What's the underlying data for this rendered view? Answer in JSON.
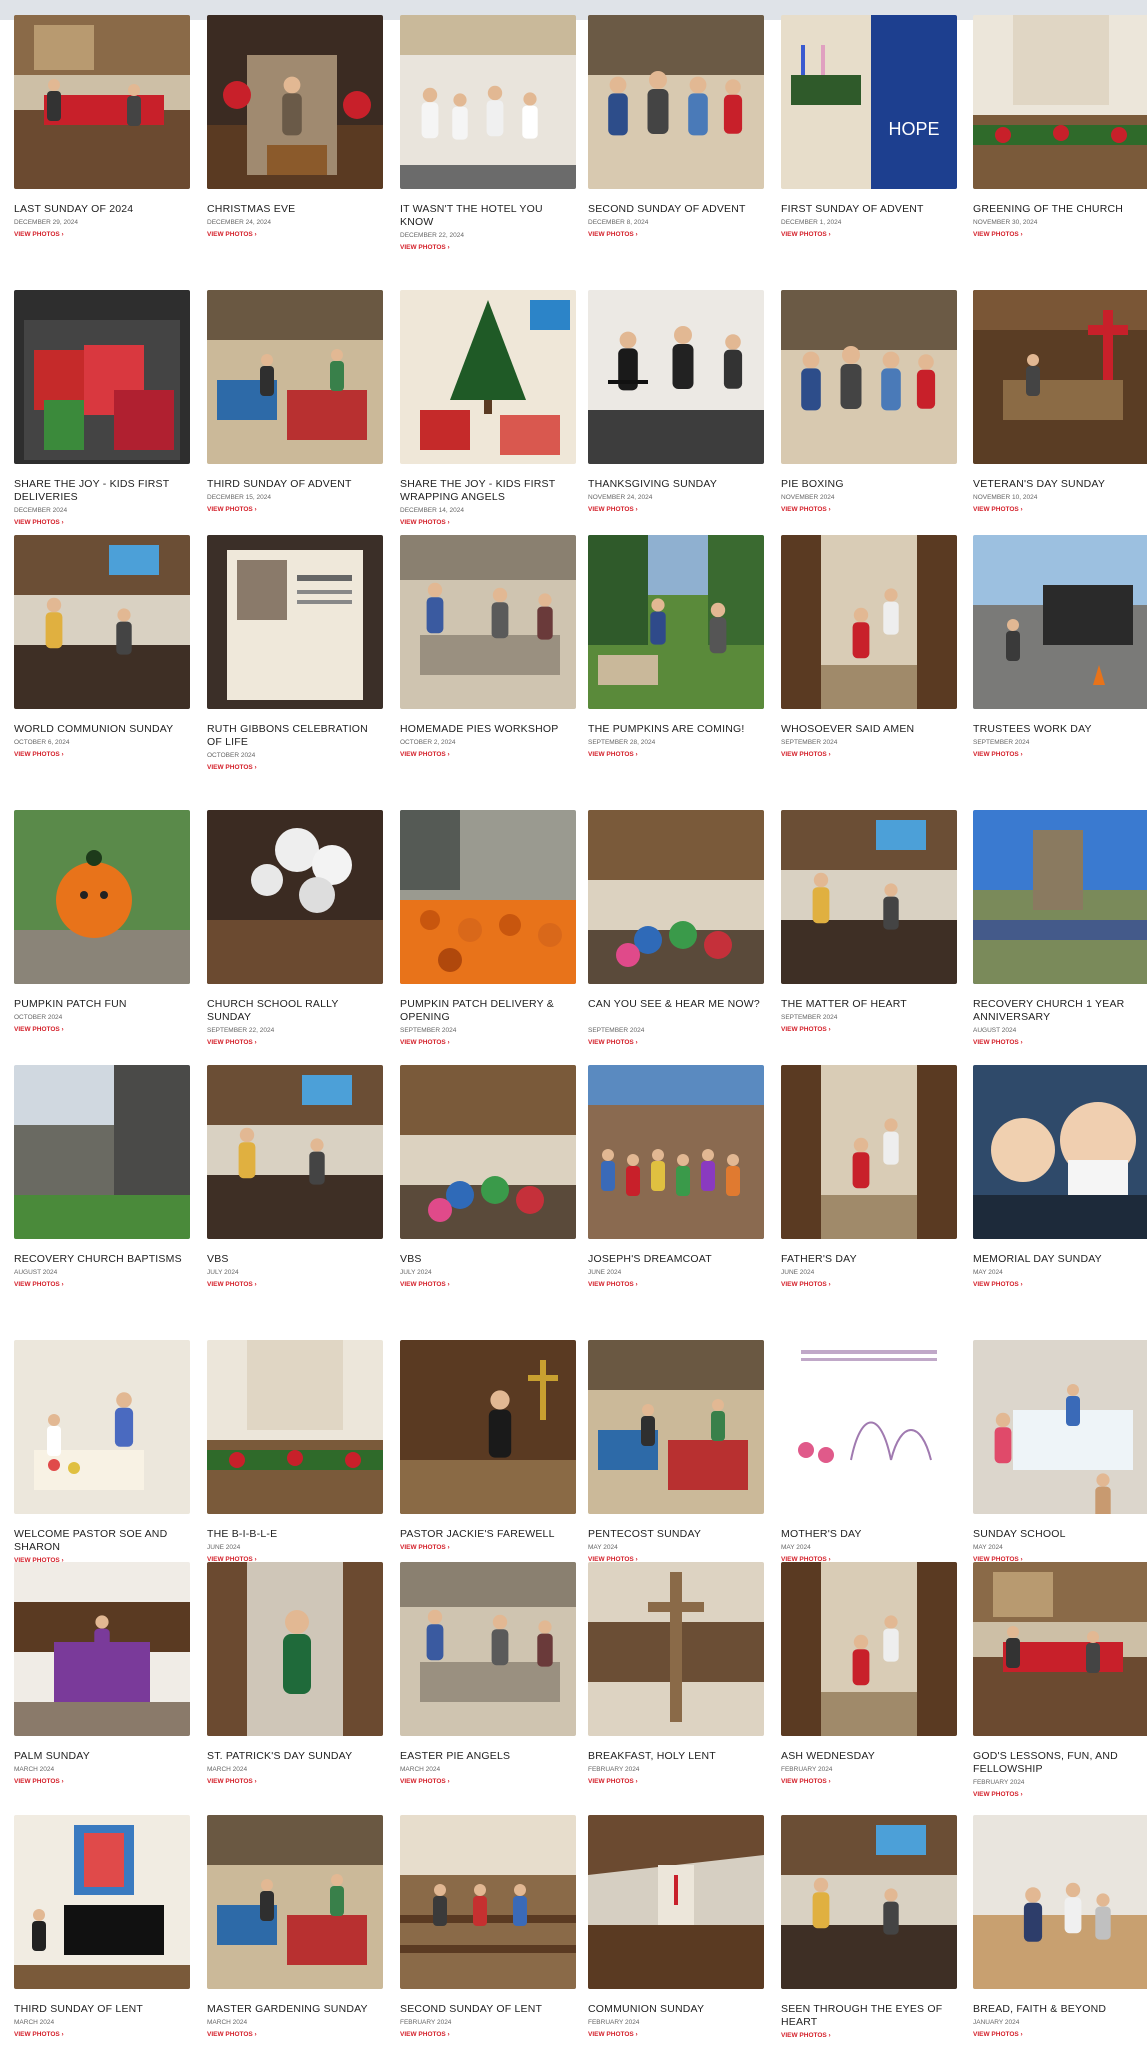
{
  "gallery": {
    "link_label": "VIEW PHOTOS ›",
    "rows": [
      [
        {
          "title": "LAST SUNDAY OF 2024",
          "date": "DECEMBER 29, 2024",
          "theme": "sanctuary-red"
        },
        {
          "title": "CHRISTMAS EVE",
          "date": "DECEMBER 24, 2024",
          "theme": "nativity"
        },
        {
          "title": "IT WASN'T THE HOTEL YOU KNOW",
          "date": "DECEMBER 22, 2024",
          "theme": "pageant"
        },
        {
          "title": "SECOND SUNDAY OF ADVENT",
          "date": "DECEMBER 8, 2024",
          "theme": "people-group"
        },
        {
          "title": "FIRST SUNDAY OF ADVENT",
          "date": "DECEMBER 1, 2024",
          "theme": "hope-banner"
        },
        {
          "title": "GREENING OF THE CHURCH",
          "date": "NOVEMBER 30, 2024",
          "theme": "chancel-green"
        }
      ],
      [
        {
          "title": "SHARE THE JOY - KIDS FIRST DELIVERIES",
          "date": "DECEMBER 2024",
          "theme": "gifts-van"
        },
        {
          "title": "THIRD SUNDAY OF ADVENT",
          "date": "DECEMBER 15, 2024",
          "theme": "hall-gifts"
        },
        {
          "title": "SHARE THE JOY - KIDS FIRST WRAPPING ANGELS",
          "date": "DECEMBER 14, 2024",
          "theme": "tree-gifts"
        },
        {
          "title": "THANKSGIVING SUNDAY",
          "date": "NOVEMBER 24, 2024",
          "theme": "music-stage"
        },
        {
          "title": "PIE BOXING",
          "date": "NOVEMBER 2024",
          "theme": "people-group"
        },
        {
          "title": "VETERAN'S DAY SUNDAY",
          "date": "NOVEMBER 10, 2024",
          "theme": "altar-cross"
        }
      ],
      [
        {
          "title": "WORLD COMMUNION SUNDAY",
          "date": "OCTOBER 6, 2024",
          "theme": "sanctuary-screen"
        },
        {
          "title": "RUTH GIBBONS CELEBRATION OF LIFE",
          "date": "OCTOBER 2024",
          "theme": "portrait-board"
        },
        {
          "title": "HOMEMADE PIES WORKSHOP",
          "date": "OCTOBER 2, 2024",
          "theme": "kitchen"
        },
        {
          "title": "THE PUMPKINS ARE COMING!",
          "date": "SEPTEMBER 28, 2024",
          "theme": "lawn"
        },
        {
          "title": "WHOSOEVER SAID AMEN",
          "date": "SEPTEMBER 2024",
          "theme": "aisle-child"
        },
        {
          "title": "TRUSTEES WORK DAY",
          "date": "SEPTEMBER 2024",
          "theme": "parking-truck"
        }
      ],
      [
        {
          "title": "PUMPKIN PATCH FUN",
          "date": "OCTOBER 2024",
          "theme": "pumpkin-costume"
        },
        {
          "title": "CHURCH SCHOOL RALLY SUNDAY",
          "date": "SEPTEMBER 22, 2024",
          "theme": "balloons"
        },
        {
          "title": "PUMPKIN PATCH DELIVERY & OPENING",
          "date": "SEPTEMBER 2024",
          "theme": "pumpkin-field"
        },
        {
          "title": "CAN YOU SEE & HEAR ME NOW?",
          "date": "SEPTEMBER 2024",
          "theme": "sanctuary-cushions"
        },
        {
          "title": "THE MATTER OF HEART",
          "date": "SEPTEMBER 2024",
          "theme": "sanctuary-screen"
        },
        {
          "title": "RECOVERY CHURCH 1 YEAR ANNIVERSARY",
          "date": "AUGUST 2024",
          "theme": "outdoor-crowd"
        }
      ],
      [
        {
          "title": "RECOVERY CHURCH BAPTISMS",
          "date": "AUGUST 2024",
          "theme": "church-exterior"
        },
        {
          "title": "VBS",
          "date": "JULY 2024",
          "theme": "sanctuary-screen"
        },
        {
          "title": "VBS",
          "date": "JULY 2024",
          "theme": "sanctuary-cushions"
        },
        {
          "title": "JOSEPH'S DREAMCOAT",
          "date": "JUNE 2024",
          "theme": "group-photo"
        },
        {
          "title": "FATHER'S DAY",
          "date": "JUNE 2024",
          "theme": "aisle-child"
        },
        {
          "title": "MEMORIAL DAY SUNDAY",
          "date": "MAY 2024",
          "theme": "selfie"
        }
      ],
      [
        {
          "title": "WELCOME PASTOR SOE AND SHARON",
          "date": "",
          "theme": "welcome-banner"
        },
        {
          "title": "THE B-I-B-L-E",
          "date": "JUNE 2024",
          "theme": "chancel-green"
        },
        {
          "title": "PASTOR JACKIE'S FAREWELL",
          "date": "",
          "theme": "pulpit"
        },
        {
          "title": "PENTECOST SUNDAY",
          "date": "MAY 2024",
          "theme": "hall-gifts"
        },
        {
          "title": "MOTHER'S DAY",
          "date": "MAY 2024",
          "theme": "drawing"
        },
        {
          "title": "SUNDAY SCHOOL",
          "date": "MAY 2024",
          "theme": "kids-table"
        }
      ],
      [
        {
          "title": "PALM SUNDAY",
          "date": "MARCH 2024",
          "theme": "altar-purple"
        },
        {
          "title": "ST. PATRICK'S DAY SUNDAY",
          "date": "MARCH 2024",
          "theme": "green-costume"
        },
        {
          "title": "EASTER PIE ANGELS",
          "date": "MARCH 2024",
          "theme": "kitchen"
        },
        {
          "title": "BREAKFAST, HOLY LENT",
          "date": "FEBRUARY 2024",
          "theme": "cross-wood"
        },
        {
          "title": "ASH WEDNESDAY",
          "date": "FEBRUARY 2024",
          "theme": "aisle-child"
        },
        {
          "title": "GOD'S LESSONS, FUN, AND FELLOWSHIP",
          "date": "FEBRUARY 2024",
          "theme": "sanctuary-red"
        }
      ],
      [
        {
          "title": "THIRD SUNDAY OF LENT",
          "date": "MARCH 2024",
          "theme": "piano-window"
        },
        {
          "title": "Master Gardening Sunday",
          "date": "MARCH 2024",
          "theme": "hall-gifts"
        },
        {
          "title": "Second Sunday of Lent",
          "date": "FEBRUARY 2024",
          "theme": "pews"
        },
        {
          "title": "COMMUNION SUNDAY",
          "date": "FEBRUARY 2024",
          "theme": "sanctuary-wide"
        },
        {
          "title": "SEEN THROUGH THE EYES OF HEART",
          "date": "",
          "theme": "sanctuary-screen"
        },
        {
          "title": "BREAD, FAITH & BEYOND",
          "date": "JANUARY 2024",
          "theme": "kids-floor"
        }
      ]
    ]
  },
  "palette": {
    "title_text": "#222222",
    "date_text": "#666666",
    "link_red": "#d4212b",
    "wood": "#5a3a22",
    "wall": "#e8e0d0",
    "pumpkin": "#e8731a",
    "church_red": "#c8202a",
    "hope_blue": "#1d3f8f"
  }
}
